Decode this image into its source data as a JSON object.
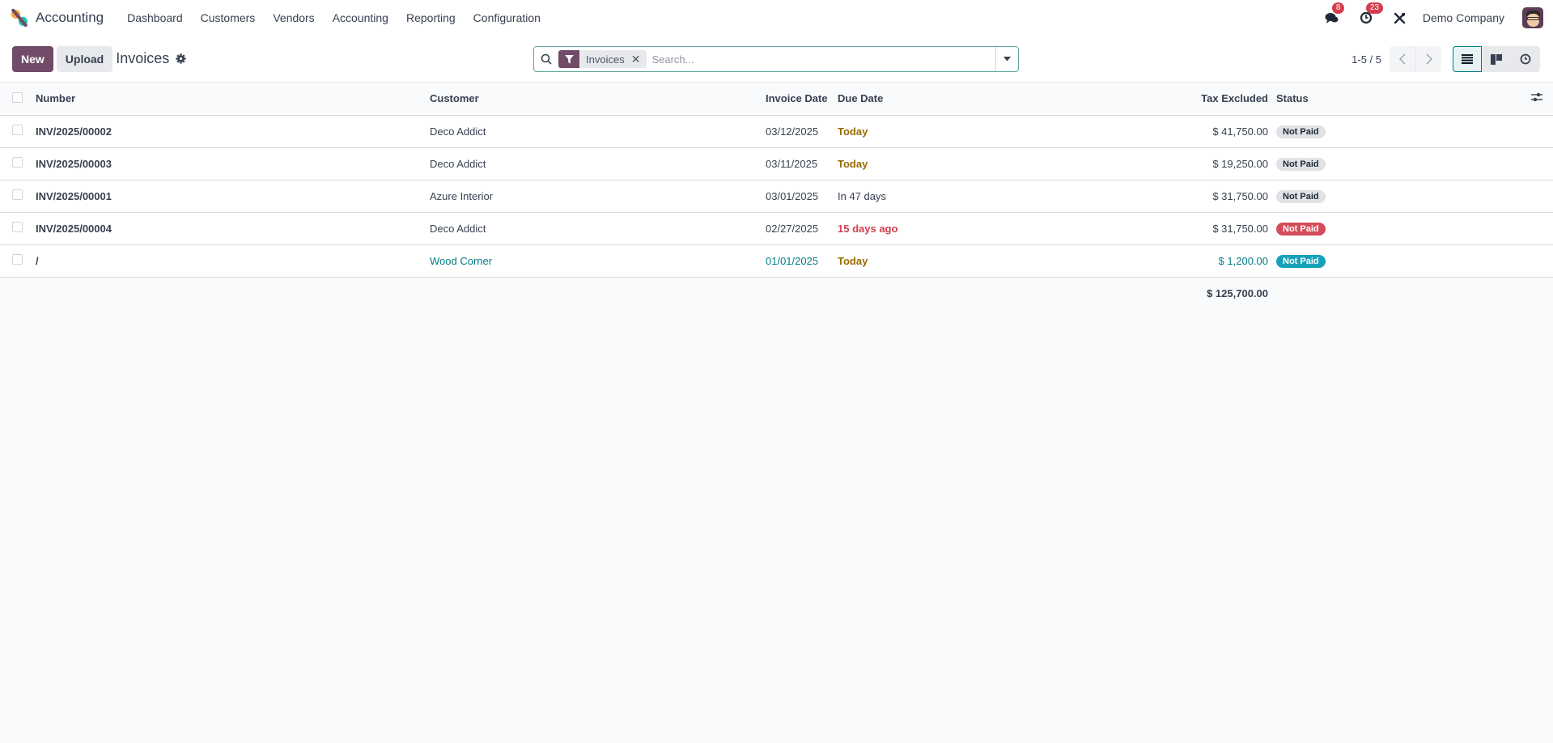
{
  "navbar": {
    "app_name": "Accounting",
    "menu": [
      "Dashboard",
      "Customers",
      "Vendors",
      "Accounting",
      "Reporting",
      "Configuration"
    ],
    "messages_count": "8",
    "activities_count": "23",
    "company": "Demo Company"
  },
  "control": {
    "new_label": "New",
    "upload_label": "Upload",
    "breadcrumb": "Invoices",
    "search": {
      "facet_label": "Invoices",
      "placeholder": "Search...",
      "value": ""
    },
    "pager": "1-5 / 5"
  },
  "table": {
    "columns": [
      "Number",
      "Customer",
      "Invoice Date",
      "Due Date",
      "Tax Excluded",
      "Status"
    ],
    "rows": [
      {
        "number": "INV/2025/00002",
        "customer": "Deco Addict",
        "invoice_date": "03/12/2025",
        "due_date": "Today",
        "due_style": "warning",
        "amount": "$ 41,750.00",
        "status": "Not Paid",
        "status_style": "muted",
        "highlight": false
      },
      {
        "number": "INV/2025/00003",
        "customer": "Deco Addict",
        "invoice_date": "03/11/2025",
        "due_date": "Today",
        "due_style": "warning",
        "amount": "$ 19,250.00",
        "status": "Not Paid",
        "status_style": "muted",
        "highlight": false
      },
      {
        "number": "INV/2025/00001",
        "customer": "Azure Interior",
        "invoice_date": "03/01/2025",
        "due_date": "In 47 days",
        "due_style": "normal",
        "amount": "$ 31,750.00",
        "status": "Not Paid",
        "status_style": "muted",
        "highlight": false
      },
      {
        "number": "INV/2025/00004",
        "customer": "Deco Addict",
        "invoice_date": "02/27/2025",
        "due_date": "15 days ago",
        "due_style": "danger",
        "amount": "$ 31,750.00",
        "status": "Not Paid",
        "status_style": "danger",
        "highlight": false
      },
      {
        "number": "/",
        "customer": "Wood Corner",
        "invoice_date": "01/01/2025",
        "due_date": "Today",
        "due_style": "warning",
        "amount": "$ 1,200.00",
        "status": "Not Paid",
        "status_style": "info",
        "highlight": true
      }
    ],
    "total": "$ 125,700.00"
  },
  "colors": {
    "brand": "#714b67",
    "accent": "#017e84",
    "danger": "#d23f50",
    "warning": "#9a6b01"
  }
}
